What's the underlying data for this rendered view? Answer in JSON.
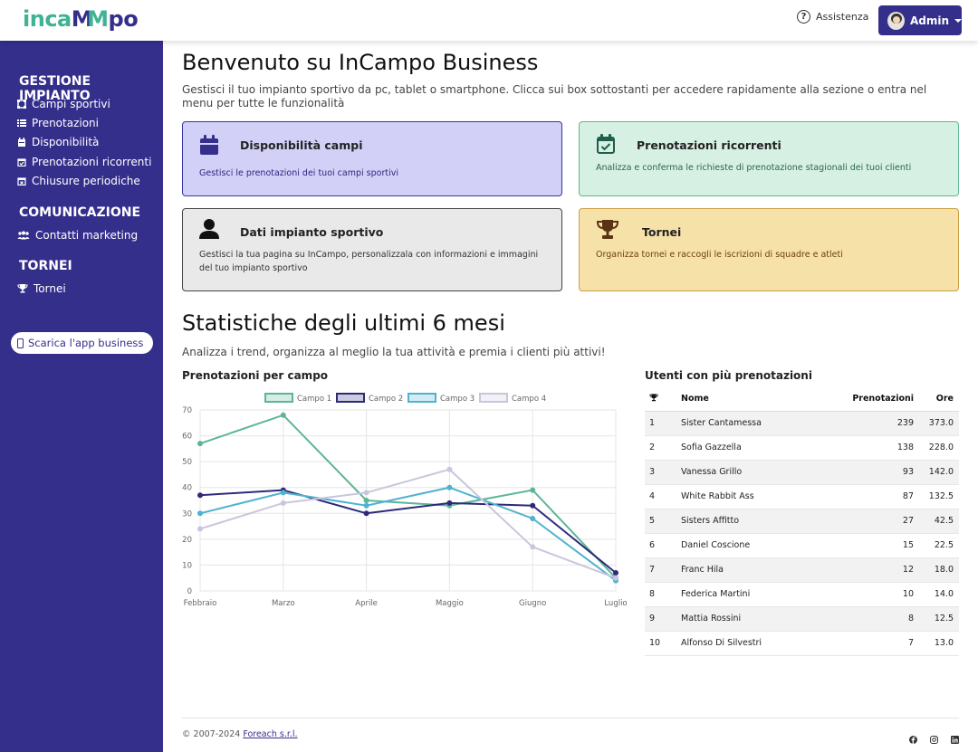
{
  "brand": {
    "part1": "inca",
    "part2": "M",
    "part3": "M",
    "part4": "po"
  },
  "header": {
    "help_label": "Assistenza",
    "admin_label": "Admin"
  },
  "sidebar": {
    "sections": [
      {
        "title": "GESTIONE IMPIANTO",
        "items": [
          {
            "label": "Campi sportivi",
            "icon": "field-icon"
          },
          {
            "label": "Prenotazioni",
            "icon": "list-icon"
          },
          {
            "label": "Disponibilità",
            "icon": "calendar-icon"
          },
          {
            "label": "Prenotazioni ricorrenti",
            "icon": "calendar-check-icon"
          },
          {
            "label": "Chiusure periodiche",
            "icon": "calendar-x-icon"
          }
        ]
      },
      {
        "title": "COMUNICAZIONE",
        "items": [
          {
            "label": "Contatti marketing",
            "icon": "users-icon"
          }
        ]
      },
      {
        "title": "TORNEI",
        "items": [
          {
            "label": "Tornei",
            "icon": "trophy-icon"
          }
        ]
      }
    ],
    "app_button": "Scarica l'app business"
  },
  "welcome": {
    "title": "Benvenuto su InCampo Business",
    "intro": "Gestisci il tuo impianto sportivo da pc, tablet o smartphone. Clicca sui box sottostanti per accedere rapidamente alla sezione o entra nel menu per tutte le funzionalità"
  },
  "cards": [
    {
      "title": "Disponibilità campi",
      "desc": "Gestisci le prenotazioni dei tuoi campi sportivi",
      "icon": "calendar-icon",
      "bg": "#d3d0f7",
      "border": "#3a35a0",
      "icon_color": "#352f8c",
      "text_color": "#2b2780"
    },
    {
      "title": "Prenotazioni ricorrenti",
      "desc": "Analizza e conferma le richieste di prenotazione stagionali dei tuoi clienti",
      "icon": "calendar-check-icon",
      "bg": "#d6f0e4",
      "border": "#5fb893",
      "icon_color": "#1f5e4b",
      "text_color": "#2b6450"
    },
    {
      "title": "Dati impianto sportivo",
      "desc": "Gestisci la tua pagina su InCampo, personalizzala con informazioni e immagini del tuo impianto sportivo",
      "icon": "person-icon",
      "bg": "#e9e9e9",
      "border": "#444444",
      "icon_color": "#111111",
      "text_color": "#333333"
    },
    {
      "title": "Tornei",
      "desc": "Organizza tornei e raccogli le iscrizioni di squadre e atleti",
      "icon": "trophy-icon",
      "bg": "#f6e1a8",
      "border": "#c9a043",
      "icon_color": "#5a3312",
      "text_color": "#6a4010"
    }
  ],
  "stats": {
    "title": "Statistiche degli ultimi 6 mesi",
    "subtitle": "Analizza i trend, organizza al meglio la tua attività e premia i clienti più attivi!",
    "chart_title": "Prenotazioni per campo",
    "table_title": "Utenti con più prenotazioni"
  },
  "chart_data": {
    "type": "line",
    "categories": [
      "Febbraio",
      "Marzo",
      "Aprile",
      "Maggio",
      "Giugno",
      "Luglio"
    ],
    "series": [
      {
        "name": "Campo 1",
        "values": [
          57,
          68,
          35,
          33,
          39,
          5
        ],
        "color": "#5bb596"
      },
      {
        "name": "Campo 2",
        "values": [
          37,
          39,
          30,
          34,
          33,
          7
        ],
        "color": "#2e2a7a"
      },
      {
        "name": "Campo 3",
        "values": [
          30,
          38,
          33,
          40,
          28,
          4
        ],
        "color": "#4fb3cf"
      },
      {
        "name": "Campo 4",
        "values": [
          24,
          34,
          38,
          47,
          17,
          5
        ],
        "color": "#c8c6dc"
      }
    ],
    "ylim": [
      0,
      70
    ],
    "yticks": [
      0,
      10,
      20,
      30,
      40,
      50,
      60,
      70
    ],
    "legend": "top",
    "grid": true
  },
  "table": {
    "headers": {
      "name": "Nome",
      "bookings": "Prenotazioni",
      "hours": "Ore"
    },
    "rows": [
      {
        "rank": "1",
        "name": "Sister Cantamessa",
        "bookings": "239",
        "hours": "373.0"
      },
      {
        "rank": "2",
        "name": "Sofia Gazzella",
        "bookings": "138",
        "hours": "228.0"
      },
      {
        "rank": "3",
        "name": "Vanessa Grillo",
        "bookings": "93",
        "hours": "142.0"
      },
      {
        "rank": "4",
        "name": "White Rabbit Ass",
        "bookings": "87",
        "hours": "132.5"
      },
      {
        "rank": "5",
        "name": "Sisters Affitto",
        "bookings": "27",
        "hours": "42.5"
      },
      {
        "rank": "6",
        "name": "Daniel Coscione",
        "bookings": "15",
        "hours": "22.5"
      },
      {
        "rank": "7",
        "name": "Franc Hila",
        "bookings": "12",
        "hours": "18.0"
      },
      {
        "rank": "8",
        "name": "Federica Martini",
        "bookings": "10",
        "hours": "14.0"
      },
      {
        "rank": "9",
        "name": "Mattia Rossini",
        "bookings": "8",
        "hours": "12.5"
      },
      {
        "rank": "10",
        "name": "Alfonso Di Silvestri",
        "bookings": "7",
        "hours": "13.0"
      }
    ]
  },
  "footer": {
    "copyright": "© 2007-2024 ",
    "company": "Foreach s.r.l.",
    "social": [
      "facebook-icon",
      "instagram-icon",
      "linkedin-icon"
    ]
  }
}
